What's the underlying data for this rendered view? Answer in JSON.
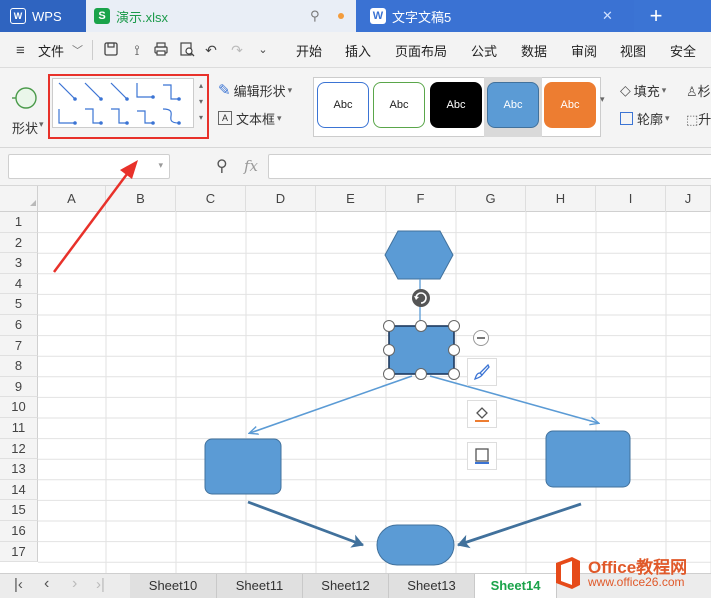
{
  "titlebar": {
    "tabs": [
      {
        "label": "WPS"
      },
      {
        "label": "演示.xlsx"
      },
      {
        "label": "文字文稿5"
      }
    ],
    "new_tab": "+"
  },
  "menubar": {
    "file_menu": "文件",
    "items": [
      "开始",
      "插入",
      "页面布局",
      "公式",
      "数据",
      "审阅",
      "视图",
      "安全"
    ]
  },
  "ribbon": {
    "shape_label": "形状",
    "edit_shape_label": "编辑形状",
    "textbox_label": "文本框",
    "fill_label": "填充",
    "outline_label": "轮廓",
    "style_previews": [
      "Abc",
      "Abc",
      "Abc",
      "Abc",
      "Abc"
    ],
    "partial_labels": [
      "杉",
      "升"
    ]
  },
  "formulabar": {
    "fx_label": "fx"
  },
  "grid": {
    "columns": [
      "A",
      "B",
      "C",
      "D",
      "E",
      "F",
      "G",
      "H",
      "I",
      "J"
    ],
    "rows": [
      "1",
      "2",
      "3",
      "4",
      "5",
      "6",
      "7",
      "8",
      "9",
      "10",
      "11",
      "12",
      "13",
      "14",
      "15",
      "16",
      "17"
    ]
  },
  "sheets": {
    "tabs": [
      "Sheet10",
      "Sheet11",
      "Sheet12",
      "Sheet13",
      "Sheet14"
    ],
    "active": "Sheet14"
  },
  "watermark": {
    "brand": "Office教程网",
    "url": "www.office26.com"
  },
  "colors": {
    "titlebar": "#3b74d4",
    "shape_fill": "#5b9bd5",
    "shape_stroke": "#41719c",
    "active_sheet": "#1aa34a",
    "highlight": "#e8312a"
  }
}
